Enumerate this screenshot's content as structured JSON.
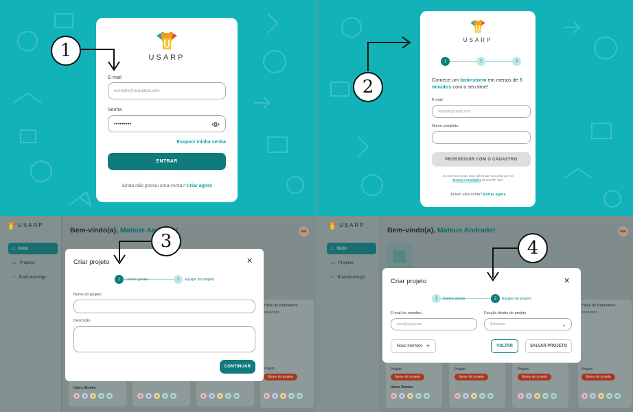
{
  "brand": "USARP",
  "colors": {
    "teal": "#12b3b8",
    "primary": "#0f7b7c",
    "link": "#0f9fa3",
    "tag": "#a4391f"
  },
  "panel1": {
    "callout": "1",
    "email_label": "E-mail",
    "email_placeholder": "exemplo@usarptool.com",
    "password_label": "Senha",
    "password_value": "•••••••••",
    "forgot": "Esqueci minha senha",
    "submit": "ENTRAR",
    "signup_prompt": "Ainda não possui uma conta?",
    "signup_link": "Criar agora",
    "eye_icon": "eye-icon"
  },
  "panel2": {
    "callout": "2",
    "steps": [
      "1",
      "2",
      "3"
    ],
    "headline_a": "Comece um ",
    "headline_b": "brainstorm",
    "headline_c": " em menos de ",
    "headline_d": "5 minutos",
    "headline_e": " com o seu time!",
    "email_label": "E-mail",
    "email_placeholder": "exemplo@usarp.com",
    "name_label": "Nome completo",
    "continue": "PROSSEGUIR COM O CADASTRO",
    "terms_a": "Ao criar uma conta, você afirma que concorda com os",
    "terms_link": "Termos e Condições",
    "terms_b": "da USARP Tool.",
    "login_prompt": "Já tem uma conta?",
    "login_link": "Entrar agora"
  },
  "dashboard": {
    "welcome": "Bem-vindo(a), ",
    "user": "Mateus Andrade!",
    "avatar": "MA",
    "nav": [
      "Início",
      "Projetos",
      "Brainstormings"
    ],
    "card_title": "Título do Brainstorm",
    "card_date": "02/10/2023",
    "project_label": "Projeto",
    "project_tag": "Nome do projeto",
    "us_label": "Users Stories",
    "us_nums": [
      "1",
      "2",
      "3",
      "4",
      "5"
    ]
  },
  "panel3": {
    "callout": "3",
    "title": "Criar projeto",
    "step1": "Dados gerais",
    "step2": "Equipe do projeto",
    "name_label": "Nome do projeto",
    "desc_label": "Descrição",
    "continue": "CONTINUAR"
  },
  "panel4": {
    "callout": "4",
    "title": "Criar projeto",
    "step1": "Dados gerais",
    "step2": "Equipe do projeto",
    "email_label": "E-mail do membro",
    "email_placeholder": "xxxx@yyyy.zzzz",
    "role_label": "Função dentro do projeto",
    "role_placeholder": "Selecione",
    "new_member": "Novo membro",
    "back": "VOLTAR",
    "save": "SALVAR PROJETO"
  }
}
